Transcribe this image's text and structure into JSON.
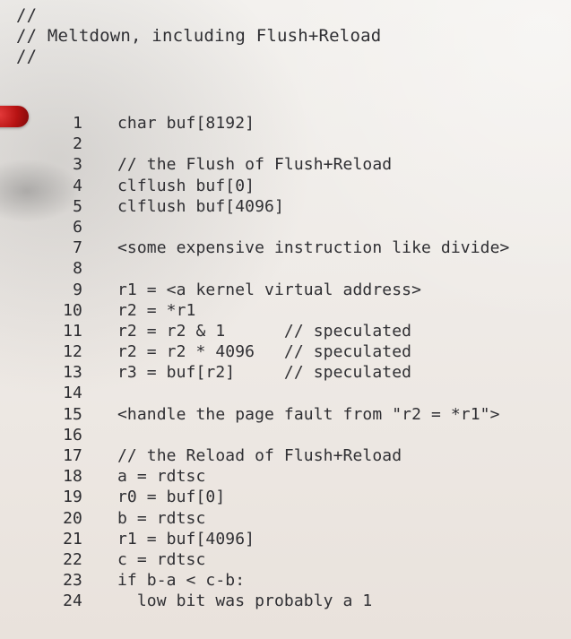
{
  "header_comment": [
    "//",
    "// Meltdown, including Flush+Reload",
    "//"
  ],
  "code_lines": [
    {
      "number": "1",
      "text": "char buf[8192]"
    },
    {
      "number": "2",
      "text": ""
    },
    {
      "number": "3",
      "text": "// the Flush of Flush+Reload"
    },
    {
      "number": "4",
      "text": "clflush buf[0]"
    },
    {
      "number": "5",
      "text": "clflush buf[4096]"
    },
    {
      "number": "6",
      "text": ""
    },
    {
      "number": "7",
      "text": "<some expensive instruction like divide>"
    },
    {
      "number": "8",
      "text": ""
    },
    {
      "number": "9",
      "text": "r1 = <a kernel virtual address>"
    },
    {
      "number": "10",
      "text": "r2 = *r1"
    },
    {
      "number": "11",
      "text": "r2 = r2 & 1      // speculated"
    },
    {
      "number": "12",
      "text": "r2 = r2 * 4096   // speculated"
    },
    {
      "number": "13",
      "text": "r3 = buf[r2]     // speculated"
    },
    {
      "number": "14",
      "text": ""
    },
    {
      "number": "15",
      "text": "<handle the page fault from \"r2 = *r1\">"
    },
    {
      "number": "16",
      "text": ""
    },
    {
      "number": "17",
      "text": "// the Reload of Flush+Reload"
    },
    {
      "number": "18",
      "text": "a = rdtsc"
    },
    {
      "number": "19",
      "text": "r0 = buf[0]"
    },
    {
      "number": "20",
      "text": "b = rdtsc"
    },
    {
      "number": "21",
      "text": "r1 = buf[4096]"
    },
    {
      "number": "22",
      "text": "c = rdtsc"
    },
    {
      "number": "23",
      "text": "if b-a < c-b:"
    },
    {
      "number": "24",
      "text": "  low bit was probably a 1"
    }
  ],
  "colors": {
    "text": "#2f2f33",
    "pointer": "#c41a1a"
  }
}
